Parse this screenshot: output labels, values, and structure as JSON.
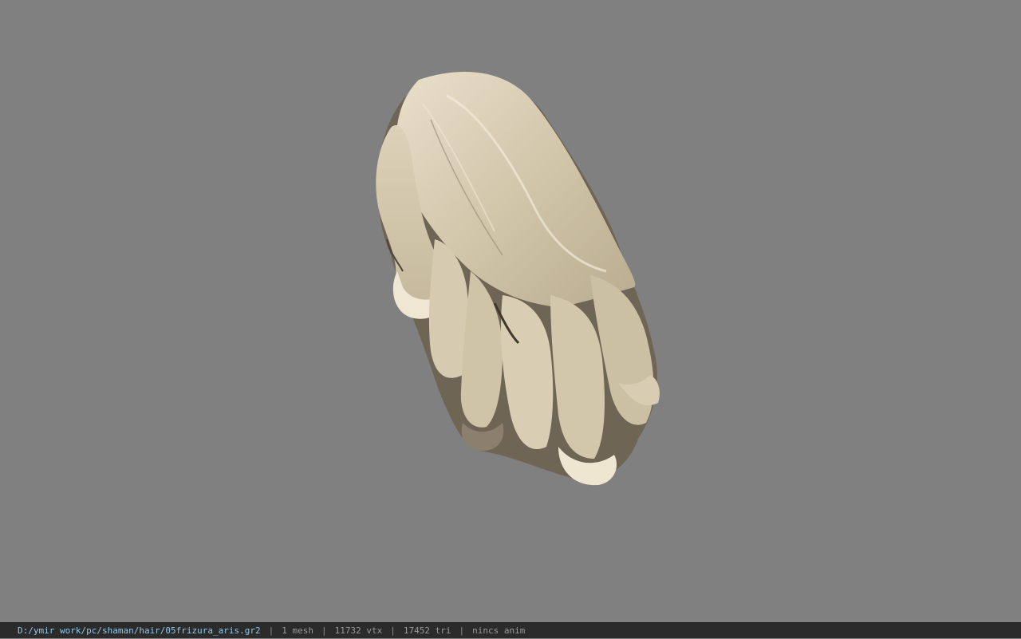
{
  "status_bar": {
    "file_path": "D:/ymir work/pc/shaman/hair/05frizura_aris.gr2",
    "separator": "|",
    "mesh_count": "1 mesh",
    "vertex_count": "11732 vtx",
    "triangle_count": "17452 tri",
    "animation": "nincs anim"
  },
  "colors": {
    "viewport_background": "#808080",
    "status_bar_background": "#2b2b2b",
    "path_text": "#8fc8e8",
    "stat_text": "#9a9a9a",
    "hair_light": "#e6dcc6",
    "hair_mid": "#c9bda2",
    "hair_shadow": "#6e6554"
  },
  "model": {
    "icon": "hair-mesh-render"
  }
}
